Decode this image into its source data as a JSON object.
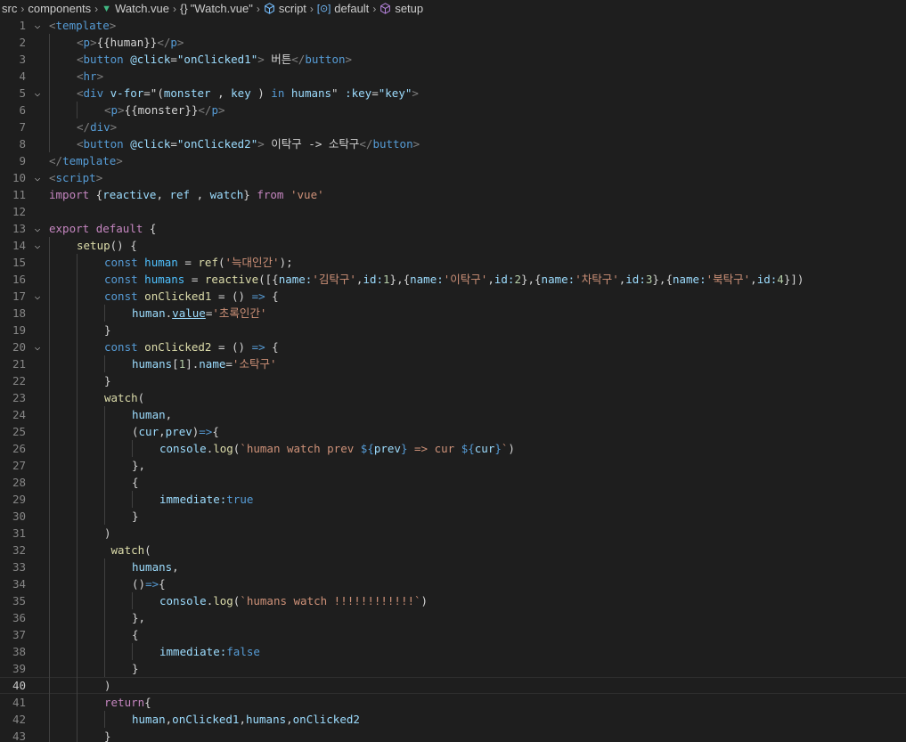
{
  "breadcrumb": {
    "items": [
      "src",
      "components",
      "Watch.vue",
      "\"Watch.vue\"",
      "script",
      "default",
      "setup"
    ],
    "icons": [
      "",
      "",
      "vue-icon",
      "braces-icon",
      "cube-icon",
      "variable-icon",
      "function-icon"
    ]
  },
  "editor": {
    "active_line": 40,
    "lines": [
      {
        "n": "1",
        "fold": true,
        "indent": 0,
        "tokens": [
          [
            "<",
            "t-tagp"
          ],
          [
            "template",
            "t-tag"
          ],
          [
            ">",
            "t-tagp"
          ]
        ]
      },
      {
        "n": "2",
        "indent": 1,
        "tokens": [
          [
            "<",
            "t-tagp"
          ],
          [
            "p",
            "t-tag"
          ],
          [
            ">",
            "t-tagp"
          ],
          [
            "{{human}}",
            "t-plain"
          ],
          [
            "</",
            "t-tagp"
          ],
          [
            "p",
            "t-tag"
          ],
          [
            ">",
            "t-tagp"
          ]
        ]
      },
      {
        "n": "3",
        "indent": 1,
        "tokens": [
          [
            "<",
            "t-tagp"
          ],
          [
            "button",
            "t-tag"
          ],
          [
            " ",
            "t-plain"
          ],
          [
            "@click",
            "t-attr"
          ],
          [
            "=",
            "t-plain"
          ],
          [
            "\"onClicked1\"",
            "t-attr"
          ],
          [
            ">",
            "t-tagp"
          ],
          [
            " 버튼",
            "t-plain"
          ],
          [
            "</",
            "t-tagp"
          ],
          [
            "button",
            "t-tag"
          ],
          [
            ">",
            "t-tagp"
          ]
        ]
      },
      {
        "n": "4",
        "indent": 1,
        "tokens": [
          [
            "<",
            "t-tagp"
          ],
          [
            "hr",
            "t-tag"
          ],
          [
            ">",
            "t-tagp"
          ]
        ]
      },
      {
        "n": "5",
        "fold": true,
        "indent": 1,
        "tokens": [
          [
            "<",
            "t-tagp"
          ],
          [
            "div",
            "t-tag"
          ],
          [
            " ",
            "t-plain"
          ],
          [
            "v-for",
            "t-attr"
          ],
          [
            "=\"",
            "t-plain"
          ],
          [
            "(",
            "t-plain"
          ],
          [
            "monster",
            "t-var"
          ],
          [
            " , ",
            "t-plain"
          ],
          [
            "key",
            "t-var"
          ],
          [
            " ) ",
            "t-plain"
          ],
          [
            "in",
            "t-kw"
          ],
          [
            " ",
            "t-plain"
          ],
          [
            "humans",
            "t-var"
          ],
          [
            "\"",
            "t-plain"
          ],
          [
            " :key",
            "t-attr"
          ],
          [
            "=",
            "t-plain"
          ],
          [
            "\"key\"",
            "t-attr"
          ],
          [
            ">",
            "t-tagp"
          ]
        ]
      },
      {
        "n": "6",
        "indent": 2,
        "tokens": [
          [
            "<",
            "t-tagp"
          ],
          [
            "p",
            "t-tag"
          ],
          [
            ">",
            "t-tagp"
          ],
          [
            "{{monster}}",
            "t-plain"
          ],
          [
            "</",
            "t-tagp"
          ],
          [
            "p",
            "t-tag"
          ],
          [
            ">",
            "t-tagp"
          ]
        ]
      },
      {
        "n": "7",
        "indent": 1,
        "tokens": [
          [
            "</",
            "t-tagp"
          ],
          [
            "div",
            "t-tag"
          ],
          [
            ">",
            "t-tagp"
          ]
        ]
      },
      {
        "n": "8",
        "indent": 1,
        "tokens": [
          [
            "<",
            "t-tagp"
          ],
          [
            "button",
            "t-tag"
          ],
          [
            " ",
            "t-plain"
          ],
          [
            "@click",
            "t-attr"
          ],
          [
            "=",
            "t-plain"
          ],
          [
            "\"onClicked2\"",
            "t-attr"
          ],
          [
            ">",
            "t-tagp"
          ],
          [
            " 이탁구 -> 소탁구",
            "t-plain"
          ],
          [
            "</",
            "t-tagp"
          ],
          [
            "button",
            "t-tag"
          ],
          [
            ">",
            "t-tagp"
          ]
        ]
      },
      {
        "n": "9",
        "indent": 0,
        "tokens": [
          [
            "</",
            "t-tagp"
          ],
          [
            "template",
            "t-tag"
          ],
          [
            ">",
            "t-tagp"
          ]
        ]
      },
      {
        "n": "10",
        "fold": true,
        "indent": 0,
        "tokens": [
          [
            "<",
            "t-tagp"
          ],
          [
            "script",
            "t-tag"
          ],
          [
            ">",
            "t-tagp"
          ]
        ]
      },
      {
        "n": "11",
        "indent": 0,
        "tokens": [
          [
            "import",
            "t-ctrl"
          ],
          [
            " {",
            "t-plain"
          ],
          [
            "reactive",
            "t-var"
          ],
          [
            ", ",
            "t-plain"
          ],
          [
            "ref",
            "t-var"
          ],
          [
            " , ",
            "t-plain"
          ],
          [
            "watch",
            "t-var"
          ],
          [
            "} ",
            "t-plain"
          ],
          [
            "from",
            "t-ctrl"
          ],
          [
            " ",
            "t-plain"
          ],
          [
            "'vue'",
            "t-str"
          ]
        ]
      },
      {
        "n": "12",
        "indent": 0,
        "tokens": []
      },
      {
        "n": "13",
        "fold": true,
        "indent": 0,
        "tokens": [
          [
            "export",
            "t-ctrl"
          ],
          [
            " ",
            "t-plain"
          ],
          [
            "default",
            "t-ctrl"
          ],
          [
            " {",
            "t-plain"
          ]
        ]
      },
      {
        "n": "14",
        "fold": true,
        "indent": 1,
        "tokens": [
          [
            "setup",
            "t-fn"
          ],
          [
            "() {",
            "t-plain"
          ]
        ]
      },
      {
        "n": "15",
        "indent": 2,
        "tokens": [
          [
            "const",
            "t-kw"
          ],
          [
            " ",
            "t-plain"
          ],
          [
            "human",
            "t-const"
          ],
          [
            " = ",
            "t-plain"
          ],
          [
            "ref",
            "t-fn"
          ],
          [
            "(",
            "t-plain"
          ],
          [
            "'늑대인간'",
            "t-str"
          ],
          [
            ");",
            "t-plain"
          ]
        ]
      },
      {
        "n": "16",
        "indent": 2,
        "tokens": [
          [
            "const",
            "t-kw"
          ],
          [
            " ",
            "t-plain"
          ],
          [
            "humans",
            "t-const"
          ],
          [
            " = ",
            "t-plain"
          ],
          [
            "reactive",
            "t-fn"
          ],
          [
            "([{",
            "t-plain"
          ],
          [
            "name:",
            "t-var"
          ],
          [
            "'김탁구'",
            "t-str"
          ],
          [
            ",",
            "t-plain"
          ],
          [
            "id:",
            "t-var"
          ],
          [
            "1",
            "t-num"
          ],
          [
            "},{",
            "t-plain"
          ],
          [
            "name:",
            "t-var"
          ],
          [
            "'이탁구'",
            "t-str"
          ],
          [
            ",",
            "t-plain"
          ],
          [
            "id:",
            "t-var"
          ],
          [
            "2",
            "t-num"
          ],
          [
            "},{",
            "t-plain"
          ],
          [
            "name:",
            "t-var"
          ],
          [
            "'차탁구'",
            "t-str"
          ],
          [
            ",",
            "t-plain"
          ],
          [
            "id:",
            "t-var"
          ],
          [
            "3",
            "t-num"
          ],
          [
            "},{",
            "t-plain"
          ],
          [
            "name:",
            "t-var"
          ],
          [
            "'북탁구'",
            "t-str"
          ],
          [
            ",",
            "t-plain"
          ],
          [
            "id:",
            "t-var"
          ],
          [
            "4",
            "t-num"
          ],
          [
            "}])",
            "t-plain"
          ]
        ]
      },
      {
        "n": "17",
        "fold": true,
        "indent": 2,
        "tokens": [
          [
            "const",
            "t-kw"
          ],
          [
            " ",
            "t-plain"
          ],
          [
            "onClicked1",
            "t-fn"
          ],
          [
            " = () ",
            "t-plain"
          ],
          [
            "=>",
            "t-kw"
          ],
          [
            " {",
            "t-plain"
          ]
        ]
      },
      {
        "n": "18",
        "indent": 3,
        "tokens": [
          [
            "human",
            "t-var"
          ],
          [
            ".",
            "t-plain"
          ],
          [
            "value",
            "t-var t-under"
          ],
          [
            "=",
            "t-plain"
          ],
          [
            "'초록인간'",
            "t-str"
          ]
        ]
      },
      {
        "n": "19",
        "indent": 2,
        "tokens": [
          [
            "}",
            "t-plain"
          ]
        ]
      },
      {
        "n": "20",
        "fold": true,
        "indent": 2,
        "tokens": [
          [
            "const",
            "t-kw"
          ],
          [
            " ",
            "t-plain"
          ],
          [
            "onClicked2",
            "t-fn"
          ],
          [
            " = () ",
            "t-plain"
          ],
          [
            "=>",
            "t-kw"
          ],
          [
            " {",
            "t-plain"
          ]
        ]
      },
      {
        "n": "21",
        "indent": 3,
        "tokens": [
          [
            "humans",
            "t-var"
          ],
          [
            "[",
            "t-plain"
          ],
          [
            "1",
            "t-num"
          ],
          [
            "].",
            "t-plain"
          ],
          [
            "name",
            "t-var"
          ],
          [
            "=",
            "t-plain"
          ],
          [
            "'소탁구'",
            "t-str"
          ]
        ]
      },
      {
        "n": "22",
        "indent": 2,
        "tokens": [
          [
            "}",
            "t-plain"
          ]
        ]
      },
      {
        "n": "23",
        "indent": 2,
        "tokens": [
          [
            "watch",
            "t-fn"
          ],
          [
            "(",
            "t-plain"
          ]
        ]
      },
      {
        "n": "24",
        "indent": 3,
        "tokens": [
          [
            "human",
            "t-var"
          ],
          [
            ",",
            "t-plain"
          ]
        ]
      },
      {
        "n": "25",
        "indent": 3,
        "tokens": [
          [
            "(",
            "t-plain"
          ],
          [
            "cur",
            "t-var"
          ],
          [
            ",",
            "t-plain"
          ],
          [
            "prev",
            "t-var"
          ],
          [
            ")",
            "t-plain"
          ],
          [
            "=>",
            "t-kw"
          ],
          [
            "{",
            "t-plain"
          ]
        ]
      },
      {
        "n": "26",
        "indent": 4,
        "tokens": [
          [
            "console",
            "t-var"
          ],
          [
            ".",
            "t-plain"
          ],
          [
            "log",
            "t-fn"
          ],
          [
            "(",
            "t-plain"
          ],
          [
            "`human watch prev ",
            "t-str"
          ],
          [
            "${",
            "t-tpl"
          ],
          [
            "prev",
            "t-var"
          ],
          [
            "}",
            "t-tpl"
          ],
          [
            " => cur ",
            "t-str"
          ],
          [
            "${",
            "t-tpl"
          ],
          [
            "cur",
            "t-var"
          ],
          [
            "}",
            "t-tpl"
          ],
          [
            "`",
            "t-str"
          ],
          [
            ")",
            "t-plain"
          ]
        ]
      },
      {
        "n": "27",
        "indent": 3,
        "tokens": [
          [
            "},",
            "t-plain"
          ]
        ]
      },
      {
        "n": "28",
        "indent": 3,
        "tokens": [
          [
            "{",
            "t-plain"
          ]
        ]
      },
      {
        "n": "29",
        "indent": 4,
        "tokens": [
          [
            "immediate:",
            "t-var"
          ],
          [
            "true",
            "t-bool"
          ]
        ]
      },
      {
        "n": "30",
        "indent": 3,
        "tokens": [
          [
            "}",
            "t-plain"
          ]
        ]
      },
      {
        "n": "31",
        "indent": 2,
        "tokens": [
          [
            ")",
            "t-plain"
          ]
        ]
      },
      {
        "n": "32",
        "indent": 2,
        "tokens": [
          [
            " watch",
            "t-fn"
          ],
          [
            "(",
            "t-plain"
          ]
        ]
      },
      {
        "n": "33",
        "indent": 3,
        "tokens": [
          [
            "humans",
            "t-var"
          ],
          [
            ",",
            "t-plain"
          ]
        ]
      },
      {
        "n": "34",
        "indent": 3,
        "tokens": [
          [
            "()",
            "t-plain"
          ],
          [
            "=>",
            "t-kw"
          ],
          [
            "{",
            "t-plain"
          ]
        ]
      },
      {
        "n": "35",
        "indent": 4,
        "tokens": [
          [
            "console",
            "t-var"
          ],
          [
            ".",
            "t-plain"
          ],
          [
            "log",
            "t-fn"
          ],
          [
            "(",
            "t-plain"
          ],
          [
            "`humans watch !!!!!!!!!!!!`",
            "t-str"
          ],
          [
            ")",
            "t-plain"
          ]
        ]
      },
      {
        "n": "36",
        "indent": 3,
        "tokens": [
          [
            "},",
            "t-plain"
          ]
        ]
      },
      {
        "n": "37",
        "indent": 3,
        "tokens": [
          [
            "{",
            "t-plain"
          ]
        ]
      },
      {
        "n": "38",
        "indent": 4,
        "tokens": [
          [
            "immediate:",
            "t-var"
          ],
          [
            "false",
            "t-bool"
          ]
        ]
      },
      {
        "n": "39",
        "indent": 3,
        "tokens": [
          [
            "}",
            "t-plain"
          ]
        ]
      },
      {
        "n": "40",
        "indent": 2,
        "tokens": [
          [
            ")",
            "t-plain"
          ]
        ]
      },
      {
        "n": "41",
        "indent": 2,
        "tokens": [
          [
            "return",
            "t-ctrl"
          ],
          [
            "{",
            "t-plain"
          ]
        ]
      },
      {
        "n": "42",
        "indent": 3,
        "tokens": [
          [
            "human",
            "t-var"
          ],
          [
            ",",
            "t-plain"
          ],
          [
            "onClicked1",
            "t-var"
          ],
          [
            ",",
            "t-plain"
          ],
          [
            "humans",
            "t-var"
          ],
          [
            ",",
            "t-plain"
          ],
          [
            "onClicked2",
            "t-var"
          ]
        ]
      },
      {
        "n": "43",
        "indent": 2,
        "tokens": [
          [
            "}",
            "t-plain"
          ]
        ]
      }
    ]
  }
}
